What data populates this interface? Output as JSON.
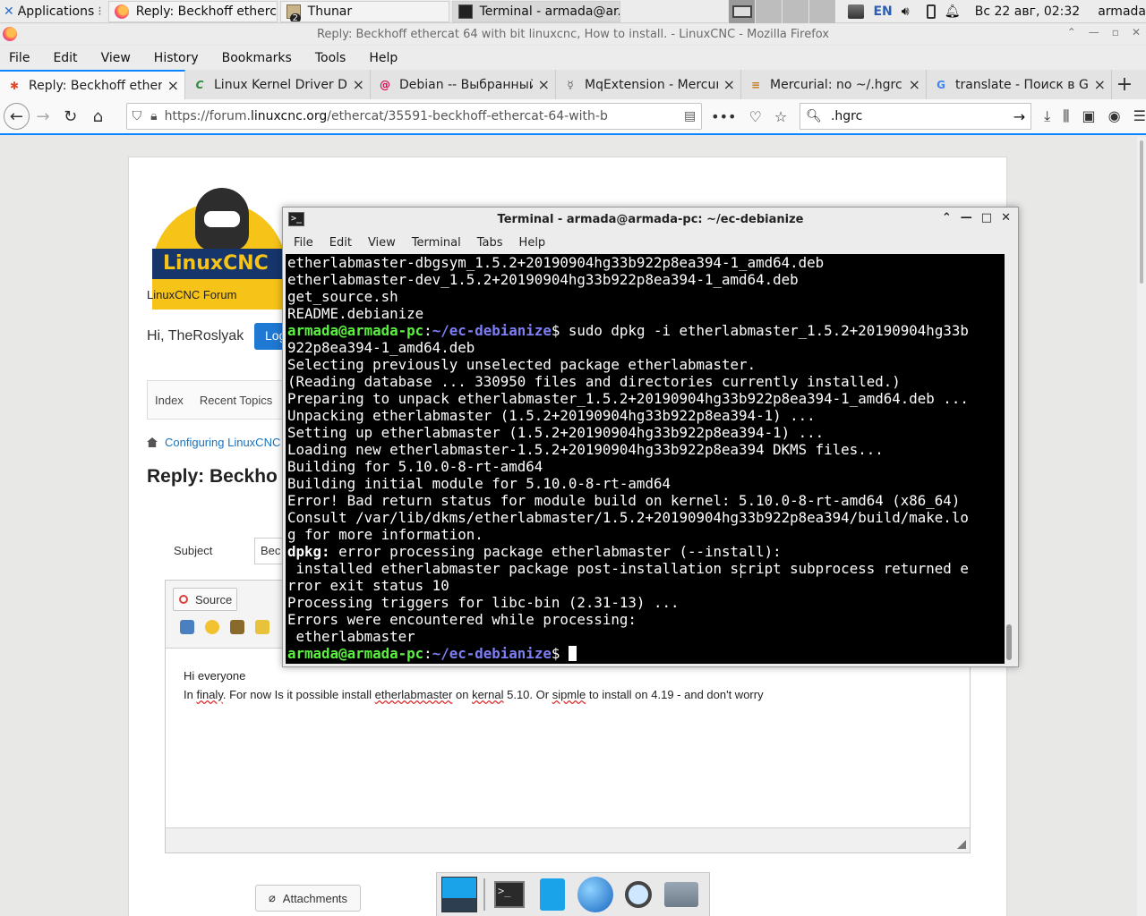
{
  "panel": {
    "applications": "Applications",
    "tasks": [
      {
        "label": "Reply: Beckhoff etherca..."
      },
      {
        "label": "Thunar",
        "badge": "2"
      },
      {
        "label": "Terminal - armada@ar..."
      }
    ],
    "lang": "EN",
    "clock": "Вс 22 авг, 02:32",
    "user": "armada"
  },
  "firefox": {
    "window_title": "Reply: Beckhoff ethercat 64 with bit linuxcnc, How to install. - LinuxCNC - Mozilla Firefox",
    "menu": [
      "File",
      "Edit",
      "View",
      "History",
      "Bookmarks",
      "Tools",
      "Help"
    ],
    "tabs": [
      {
        "label": "Reply: Beckhoff etherc",
        "fav": "joomla"
      },
      {
        "label": "Linux Kernel Driver Da",
        "fav": "C"
      },
      {
        "label": "Debian -- Выбранный",
        "fav": "debian"
      },
      {
        "label": "MqExtension - Mercuri",
        "fav": "merc"
      },
      {
        "label": "Mercurial: no ~/.hgrc",
        "fav": "hg"
      },
      {
        "label": "translate - Поиск в Go",
        "fav": "G"
      }
    ],
    "url_prefix": "https://forum.",
    "url_host": "linuxcnc.org",
    "url_path": "/ethercat/35591-beckhoff-ethercat-64-with-b",
    "search_value": ".hgrc"
  },
  "page": {
    "forum_name": "LinuxCNC Forum",
    "logo_text": "LinuxCNC",
    "greeting": "Hi, TheRoslyak",
    "login_label": "Log",
    "nav": [
      "Index",
      "Recent Topics"
    ],
    "breadcrumb": "Configuring LinuxCNC",
    "heading": "Reply: Beckho",
    "subject_label": "Subject",
    "subject_value": "Bec",
    "source_button": "Source",
    "body_line1": "Hi everyone",
    "body_line2_parts": [
      "In ",
      "finaly",
      ". For now Is it possible install  ",
      "etherlabmaster",
      " on ",
      "kernal",
      " 5.10. Or ",
      "sipmle",
      " to install on 4.19 - and don't worry"
    ],
    "attachments": "Attachments"
  },
  "terminal": {
    "title": "Terminal - armada@armada-pc: ~/ec-debianize",
    "menu": [
      "File",
      "Edit",
      "View",
      "Terminal",
      "Tabs",
      "Help"
    ],
    "prompt_user": "armada@armada-pc",
    "prompt_path": "~/ec-debianize",
    "lines": {
      "l01": "etherlabmaster-dbgsym_1.5.2+20190904hg33b922p8ea394-1_amd64.deb",
      "l02": "etherlabmaster-dev_1.5.2+20190904hg33b922p8ea394-1_amd64.deb",
      "l03": "get_source.sh",
      "l04": "README.debianize",
      "l05_cmd": "$ sudo dpkg -i etherlabmaster_1.5.2+20190904hg33b",
      "l06": "922p8ea394-1_amd64.deb",
      "l07": "Selecting previously unselected package etherlabmaster.",
      "l08": "(Reading database ... 330950 files and directories currently installed.)",
      "l09": "Preparing to unpack etherlabmaster_1.5.2+20190904hg33b922p8ea394-1_amd64.deb ...",
      "l10": "Unpacking etherlabmaster (1.5.2+20190904hg33b922p8ea394-1) ...",
      "l11": "Setting up etherlabmaster (1.5.2+20190904hg33b922p8ea394-1) ...",
      "l12": "Loading new etherlabmaster-1.5.2+20190904hg33b922p8ea394 DKMS files...",
      "l13": "Building for 5.10.0-8-rt-amd64",
      "l14": "Building initial module for 5.10.0-8-rt-amd64",
      "l15": "Error! Bad return status for module build on kernel: 5.10.0-8-rt-amd64 (x86_64)",
      "l16": "Consult /var/lib/dkms/etherlabmaster/1.5.2+20190904hg33b922p8ea394/build/make.lo",
      "l17": "g for more information.",
      "l18_bold": "dpkg:",
      "l18_rest": " error processing package etherlabmaster (--install):",
      "l19": " installed etherlabmaster package post-installation script subprocess returned e",
      "l20": "rror exit status 10",
      "l21": "Processing triggers for libc-bin (2.31-13) ...",
      "l22": "Errors were encountered while processing:",
      "l23": " etherlabmaster",
      "l24_cmd": "$ "
    }
  },
  "colors": {
    "accent": "#0a84ff",
    "prompt_user": "#5af23f",
    "prompt_path": "#7e7ef5"
  }
}
